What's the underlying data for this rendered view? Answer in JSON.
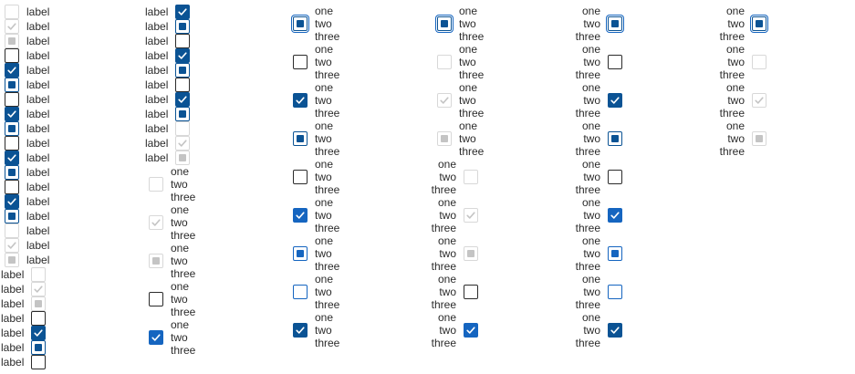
{
  "single_label": "label",
  "multi_lines": [
    "one",
    "two",
    "three"
  ],
  "colors": {
    "accent": "#0b5394",
    "focus": "#1565c0",
    "disabled": "#d8d8d8"
  }
}
